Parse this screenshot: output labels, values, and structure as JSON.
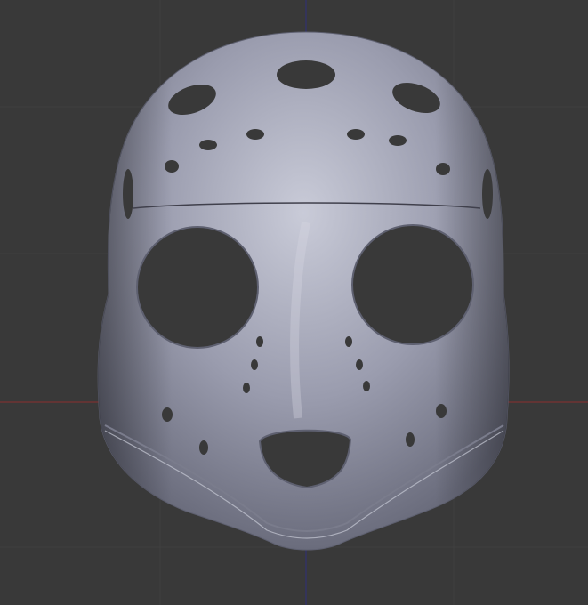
{
  "viewport": {
    "background_color": "#393939",
    "axis_x_color": "#8a2e2e",
    "axis_z_color": "#2e2e7a"
  },
  "model": {
    "kind": "hockey-goalie-mask",
    "surface_color": "#9a9cae",
    "highlight_color": "#c9cbd8",
    "shadow_color": "#6a6c7c",
    "hole_color": "#393939"
  }
}
